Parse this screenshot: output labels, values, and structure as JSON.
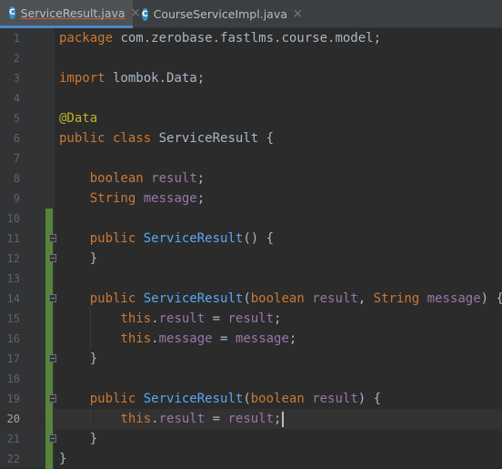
{
  "tabs": [
    {
      "label": "ServiceResult.java",
      "icon": "java-class-icon",
      "icon_letter": "C",
      "active": true
    },
    {
      "label": "CourseServiceImpl.java",
      "icon": "java-class-icon",
      "icon_letter": "C",
      "active": false
    }
  ],
  "close_glyph": "×",
  "current_line": 20,
  "colors": {
    "background": "#2b2b2b",
    "keyword": "#cc7832",
    "annotation": "#bbb529",
    "field": "#9876aa",
    "method": "#56a8f5",
    "text": "#a9b7c6",
    "change_marker": "#57843c"
  },
  "lines": [
    {
      "number": "1",
      "segments": [
        {
          "text": "package",
          "t": "kw"
        },
        {
          "text": " com.zerobase.fastlms.course.model;",
          "t": "plain"
        }
      ]
    },
    {
      "number": "2",
      "segments": []
    },
    {
      "number": "3",
      "segments": [
        {
          "text": "import",
          "t": "kw"
        },
        {
          "text": " lombok.Data;",
          "t": "plain"
        }
      ]
    },
    {
      "number": "4",
      "segments": []
    },
    {
      "number": "5",
      "segments": [
        {
          "text": "@Data",
          "t": "ann"
        }
      ]
    },
    {
      "number": "6",
      "segments": [
        {
          "text": "public class",
          "t": "kw"
        },
        {
          "text": " ServiceResult {",
          "t": "plain"
        }
      ]
    },
    {
      "number": "7",
      "segments": []
    },
    {
      "number": "8",
      "segments": [
        {
          "text": "    ",
          "t": "plain"
        },
        {
          "text": "boolean",
          "t": "kw"
        },
        {
          "text": " ",
          "t": "plain"
        },
        {
          "text": "result",
          "t": "field"
        },
        {
          "text": ";",
          "t": "plain"
        }
      ]
    },
    {
      "number": "9",
      "segments": [
        {
          "text": "    ",
          "t": "plain"
        },
        {
          "text": "String",
          "t": "kw"
        },
        {
          "text": " ",
          "t": "plain"
        },
        {
          "text": "message",
          "t": "field"
        },
        {
          "text": ";",
          "t": "plain"
        }
      ]
    },
    {
      "number": "10",
      "segments": []
    },
    {
      "number": "11",
      "segments": [
        {
          "text": "    ",
          "t": "plain"
        },
        {
          "text": "public",
          "t": "kw"
        },
        {
          "text": " ",
          "t": "plain"
        },
        {
          "text": "ServiceResult",
          "t": "method"
        },
        {
          "text": "() {",
          "t": "plain"
        }
      ]
    },
    {
      "number": "12",
      "segments": [
        {
          "text": "    }",
          "t": "plain"
        }
      ]
    },
    {
      "number": "13",
      "segments": []
    },
    {
      "number": "14",
      "segments": [
        {
          "text": "    ",
          "t": "plain"
        },
        {
          "text": "public",
          "t": "kw"
        },
        {
          "text": " ",
          "t": "plain"
        },
        {
          "text": "ServiceResult",
          "t": "method"
        },
        {
          "text": "(",
          "t": "plain"
        },
        {
          "text": "boolean",
          "t": "kw"
        },
        {
          "text": " ",
          "t": "plain"
        },
        {
          "text": "result",
          "t": "field"
        },
        {
          "text": ", ",
          "t": "plain"
        },
        {
          "text": "String",
          "t": "kw"
        },
        {
          "text": " ",
          "t": "plain"
        },
        {
          "text": "message",
          "t": "field"
        },
        {
          "text": ") {",
          "t": "plain"
        }
      ]
    },
    {
      "number": "15",
      "segments": [
        {
          "text": "        ",
          "t": "plain"
        },
        {
          "text": "this",
          "t": "kw"
        },
        {
          "text": ".",
          "t": "plain"
        },
        {
          "text": "result",
          "t": "field"
        },
        {
          "text": " = ",
          "t": "plain"
        },
        {
          "text": "result",
          "t": "field"
        },
        {
          "text": ";",
          "t": "plain"
        }
      ]
    },
    {
      "number": "16",
      "segments": [
        {
          "text": "        ",
          "t": "plain"
        },
        {
          "text": "this",
          "t": "kw"
        },
        {
          "text": ".",
          "t": "plain"
        },
        {
          "text": "message",
          "t": "field"
        },
        {
          "text": " = ",
          "t": "plain"
        },
        {
          "text": "message",
          "t": "field"
        },
        {
          "text": ";",
          "t": "plain"
        }
      ]
    },
    {
      "number": "17",
      "segments": [
        {
          "text": "    }",
          "t": "plain"
        }
      ]
    },
    {
      "number": "18",
      "segments": []
    },
    {
      "number": "19",
      "segments": [
        {
          "text": "    ",
          "t": "plain"
        },
        {
          "text": "public",
          "t": "kw"
        },
        {
          "text": " ",
          "t": "plain"
        },
        {
          "text": "ServiceResult",
          "t": "method"
        },
        {
          "text": "(",
          "t": "plain"
        },
        {
          "text": "boolean",
          "t": "kw"
        },
        {
          "text": " ",
          "t": "plain"
        },
        {
          "text": "result",
          "t": "field"
        },
        {
          "text": ") {",
          "t": "plain"
        }
      ]
    },
    {
      "number": "20",
      "segments": [
        {
          "text": "        ",
          "t": "plain"
        },
        {
          "text": "this",
          "t": "kw"
        },
        {
          "text": ".",
          "t": "plain"
        },
        {
          "text": "result",
          "t": "field"
        },
        {
          "text": " = ",
          "t": "plain"
        },
        {
          "text": "result",
          "t": "field"
        },
        {
          "text": ";",
          "t": "plain"
        }
      ]
    },
    {
      "number": "21",
      "segments": [
        {
          "text": "    }",
          "t": "plain"
        }
      ]
    },
    {
      "number": "22",
      "segments": [
        {
          "text": "}",
          "t": "plain"
        }
      ]
    }
  ]
}
